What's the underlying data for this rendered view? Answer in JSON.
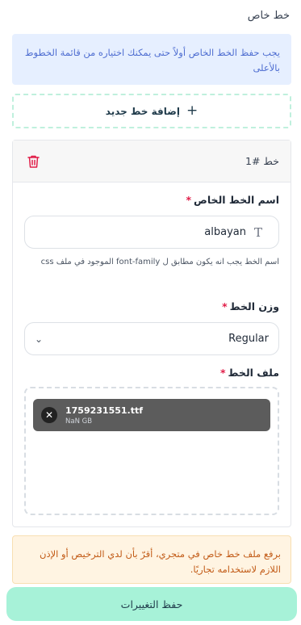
{
  "page": {
    "title": "خط خاص"
  },
  "info": {
    "text": "يجب حفظ الخط الخاص أولاً حتى يمكنك اختياره من قائمة الخطوط بالأعلى"
  },
  "add_font": {
    "label": "إضافة خط جديد",
    "icon": "+"
  },
  "font_card": {
    "title": "خط #1",
    "name_field": {
      "label": "اسم الخط الخاص",
      "required_mark": "*",
      "value": "albayan",
      "icon": "T",
      "hint": "اسم الخط يجب انه يكون مطابق ل font-family الموجود في ملف css"
    },
    "weight_field": {
      "label": "وزن الخط",
      "required_mark": "*",
      "value": "Regular",
      "chevron": "⌄"
    },
    "file_field": {
      "label": "ملف الخط",
      "required_mark": "*",
      "file_name": "1759231551.ttf",
      "file_size": "NaN GB",
      "remove_icon": "✕"
    }
  },
  "license": {
    "text": "برفع ملف خط خاص في متجري، أقرّ بأن لدي الترخيص أو الإذن اللازم لاستخدامه تجاريًا."
  },
  "save_button": {
    "label": "حفظ التغييرات"
  },
  "colors": {
    "info_bg": "#e6efff",
    "info_text": "#4f6ed1",
    "license_bg": "#fff4e2",
    "license_text": "#c25b17",
    "save_bg": "#a7f2d8",
    "required": "#e11d48",
    "trash": "#e11d48"
  }
}
